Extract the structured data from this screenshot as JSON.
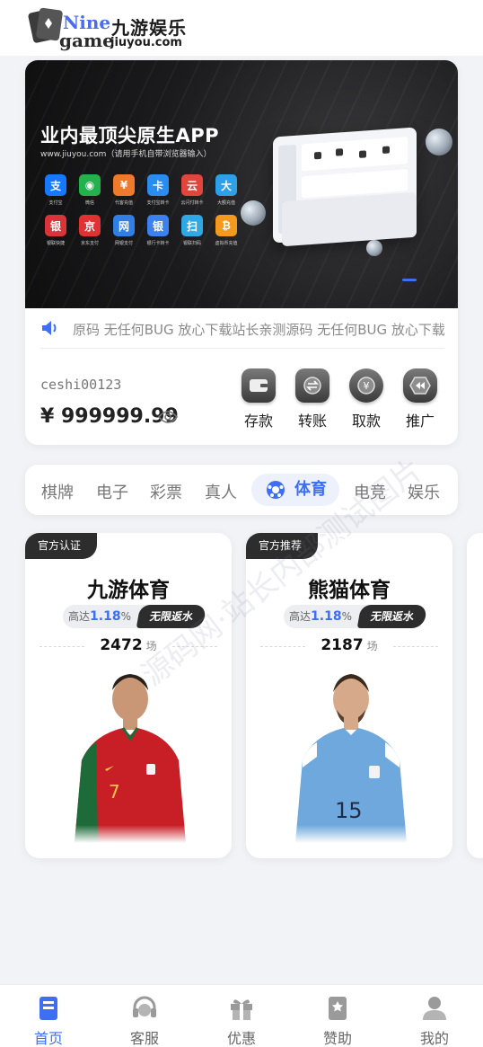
{
  "header": {
    "logo_nine": "Nine",
    "logo_game": "game",
    "logo_cn": "九游娱乐",
    "logo_url": "jiuyou.com"
  },
  "banner": {
    "title": "业内最顶尖原生APP",
    "subtitle": "www.jiuyou.com（请用手机自带浏览器输入）",
    "payments": [
      {
        "label": "支付宝",
        "icon": "alipay-icon",
        "glyph": "支",
        "color": "#1677ff"
      },
      {
        "label": "微信",
        "icon": "wechat-icon",
        "glyph": "◉",
        "color": "#22b14c"
      },
      {
        "label": "代客充值",
        "icon": "agent-recharge-icon",
        "glyph": "¥",
        "color": "#f07a2c"
      },
      {
        "label": "支付宝转卡",
        "icon": "alipay-card-icon",
        "glyph": "卡",
        "color": "#2a8cf0"
      },
      {
        "label": "云闪付转卡",
        "icon": "unionpay-transfer-icon",
        "glyph": "云",
        "color": "#e0463b"
      },
      {
        "label": "大额充值",
        "icon": "large-deposit-icon",
        "glyph": "大",
        "color": "#2fa0e8"
      },
      {
        "label": "银联快捷",
        "icon": "unionpay-quick-icon",
        "glyph": "银",
        "color": "#d8343a"
      },
      {
        "label": "京东支付",
        "icon": "jdpay-icon",
        "glyph": "京",
        "color": "#e03232"
      },
      {
        "label": "网银支付",
        "icon": "netbank-icon",
        "glyph": "网",
        "color": "#2f7fe6"
      },
      {
        "label": "银行卡转卡",
        "icon": "bank-transfer-icon",
        "glyph": "银",
        "color": "#3b82f0"
      },
      {
        "label": "银联扫码",
        "icon": "unionpay-scan-icon",
        "glyph": "扫",
        "color": "#2fa9e6"
      },
      {
        "label": "虚拟币充值",
        "icon": "crypto-icon",
        "glyph": "₿",
        "color": "#f39a1e"
      }
    ]
  },
  "notice": {
    "text": "原码 无任何BUG 放心下载站长亲测源码 无任何BUG 放心下载站长亲测源码"
  },
  "account": {
    "username": "ceshi00123",
    "balance": "¥ 999999.99",
    "actions": [
      {
        "label": "存款",
        "icon": "wallet-icon"
      },
      {
        "label": "转账",
        "icon": "transfer-icon"
      },
      {
        "label": "取款",
        "icon": "withdraw-icon"
      },
      {
        "label": "推广",
        "icon": "promote-icon"
      }
    ]
  },
  "categories": {
    "tabs": [
      "棋牌",
      "电子",
      "彩票",
      "真人",
      "体育",
      "电竞",
      "娱乐"
    ],
    "active": "体育"
  },
  "cards": [
    {
      "badge": "官方认证",
      "title": "九游体育",
      "rate_prefix": "高达",
      "rate_value": "1.18",
      "rate_suffix": "%",
      "tag": "无限返水",
      "matches": "2472",
      "matches_unit": "场",
      "jersey_color": "#c81e25",
      "jersey_number": "7"
    },
    {
      "badge": "官方推荐",
      "title": "熊猫体育",
      "rate_prefix": "高达",
      "rate_value": "1.18",
      "rate_suffix": "%",
      "tag": "无限返水",
      "matches": "2187",
      "matches_unit": "场",
      "jersey_color": "#6fa8dc",
      "jersey_number": "15"
    }
  ],
  "watermark": "源码网·站长内部测试图片",
  "bottom_nav": [
    {
      "label": "首页",
      "icon": "home-icon",
      "active": true
    },
    {
      "label": "客服",
      "icon": "customer-service-icon",
      "active": false
    },
    {
      "label": "优惠",
      "icon": "gift-icon",
      "active": false
    },
    {
      "label": "赞助",
      "icon": "sponsor-icon",
      "active": false
    },
    {
      "label": "我的",
      "icon": "user-icon",
      "active": false
    }
  ],
  "colors": {
    "accent": "#3d6ff2",
    "dark": "#2d2d2d"
  }
}
